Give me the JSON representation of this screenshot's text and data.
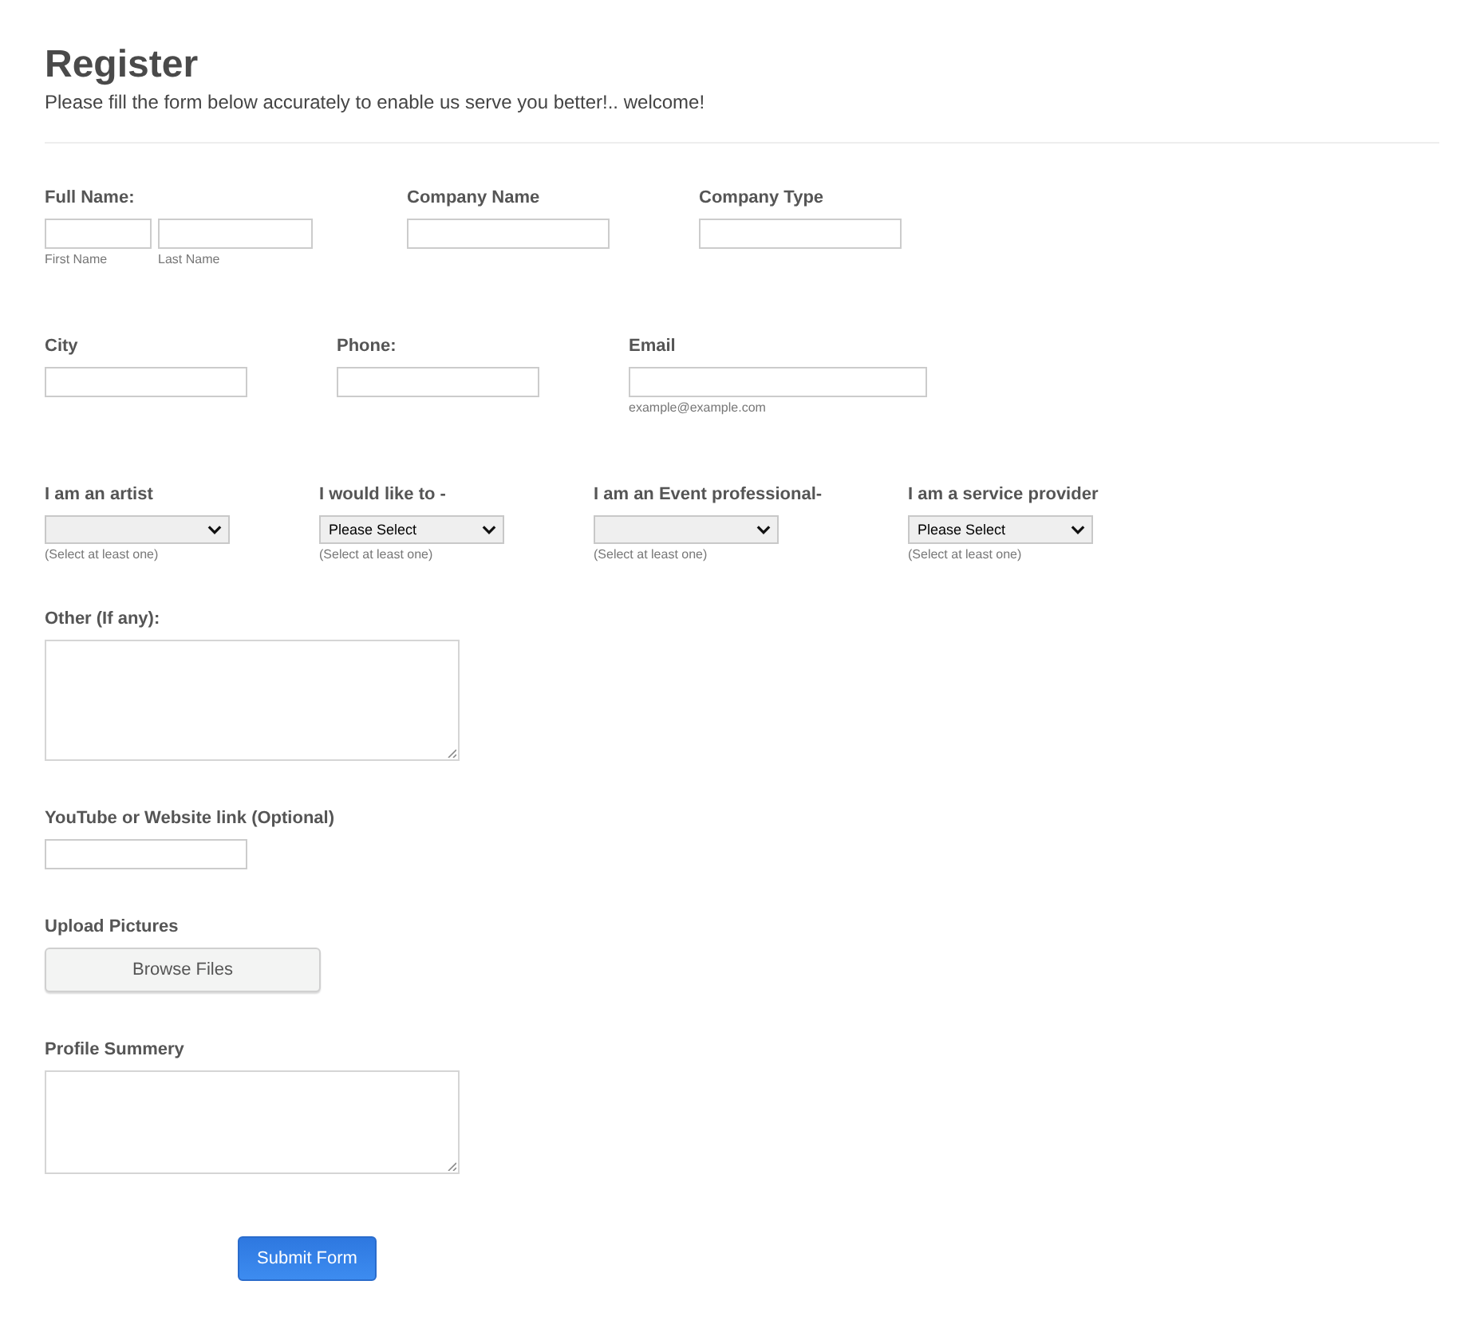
{
  "header": {
    "title": "Register",
    "subtitle": "Please fill the form below accurately to enable us serve you better!.. welcome!"
  },
  "rows": [
    {
      "fields": [
        {
          "kind": "name",
          "label": "Full Name:",
          "parts": [
            {
              "sublabel": "First Name"
            },
            {
              "sublabel": "Last Name"
            }
          ]
        },
        {
          "kind": "text",
          "label": "Company Name"
        },
        {
          "kind": "text",
          "label": "Company Type"
        }
      ]
    },
    {
      "fields": [
        {
          "kind": "text",
          "label": "City"
        },
        {
          "kind": "text",
          "label": "Phone:"
        },
        {
          "kind": "text",
          "label": "Email",
          "hint": "example@example.com"
        }
      ]
    },
    {
      "fields": [
        {
          "kind": "select",
          "label": "I am an artist",
          "hint": "(Select at least one)"
        },
        {
          "kind": "select",
          "label": "I would like to -",
          "value": "Please Select",
          "hint": "(Select at least one)"
        },
        {
          "kind": "select",
          "label": "I am an Event professional-",
          "hint": "(Select at least one)"
        },
        {
          "kind": "select",
          "label": "I am a service provider",
          "value": "Please Select",
          "hint": "(Select at least one)"
        }
      ]
    },
    {
      "fields": [
        {
          "kind": "textarea",
          "label": "Other (If any):"
        }
      ]
    },
    {
      "fields": [
        {
          "kind": "text",
          "label": "YouTube or Website link (Optional)"
        }
      ]
    },
    {
      "fields": [
        {
          "kind": "file",
          "label": "Upload Pictures",
          "button": "Browse Files"
        }
      ]
    },
    {
      "fields": [
        {
          "kind": "textarea",
          "label": "Profile Summery"
        }
      ]
    }
  ],
  "submit": "Submit Form"
}
